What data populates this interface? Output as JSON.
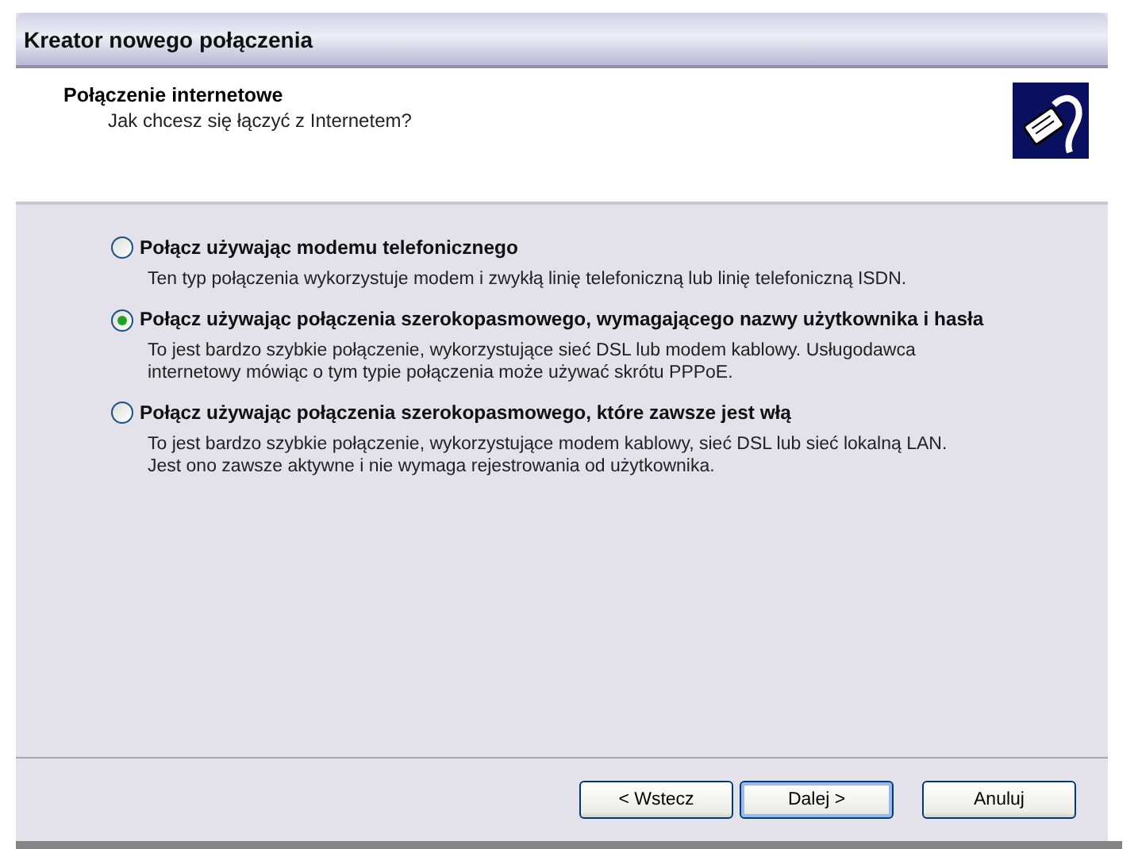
{
  "window": {
    "title": "Kreator nowego połączenia"
  },
  "header": {
    "title": "Połączenie internetowe",
    "subtitle": "Jak chcesz się łączyć z Internetem?"
  },
  "options": [
    {
      "label": "Połącz używając modemu telefonicznego",
      "description": "Ten typ połączenia wykorzystuje modem i zwykłą linię telefoniczną lub linię telefoniczną ISDN.",
      "selected": false
    },
    {
      "label": "Połącz używając połączenia szerokopasmowego, wymagającego nazwy użytkownika i hasła",
      "description": "To jest bardzo szybkie połączenie, wykorzystujące sieć DSL lub modem kablowy. Usługodawca internetowy mówiąc o tym typie połączenia może używać skrótu PPPoE.",
      "selected": true
    },
    {
      "label": "Połącz używając połączenia szerokopasmowego, które zawsze jest włą",
      "description": "To jest bardzo szybkie połączenie, wykorzystujące modem kablowy, sieć DSL lub sieć lokalną LAN. Jest ono zawsze aktywne i nie wymaga rejestrowania od użytkownika.",
      "selected": false
    }
  ],
  "buttons": [
    {
      "label": "< Wstecz",
      "default": false
    },
    {
      "label": "Dalej >",
      "default": true
    },
    {
      "label": "Anuluj",
      "default": false
    }
  ]
}
